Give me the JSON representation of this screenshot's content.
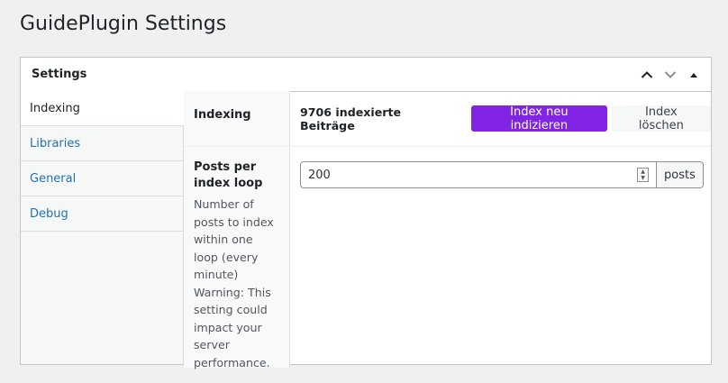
{
  "page": {
    "title": "GuidePlugin Settings"
  },
  "postbox": {
    "title": "Settings",
    "actions": {
      "move_up": "chevron-up-icon",
      "move_down": "chevron-down-icon",
      "toggle": "triangle-up-icon"
    }
  },
  "tabs": [
    {
      "label": "Indexing",
      "active": true
    },
    {
      "label": "Libraries",
      "active": false
    },
    {
      "label": "General",
      "active": false
    },
    {
      "label": "Debug",
      "active": false
    }
  ],
  "indexing": {
    "label": "Indexing",
    "count_text": "9706 indexierte Beiträge",
    "reindex_button": "Index neu indizieren",
    "delete_button": "Index löschen"
  },
  "posts_per_loop": {
    "label": "Posts per index loop",
    "description": "Number of posts to index within one loop (every minute) Warning: This setting could impact your server performance.",
    "value": "200",
    "suffix": "posts"
  },
  "colors": {
    "accent": "#8224e3",
    "link": "#2271b1",
    "background": "#f0f0f1"
  }
}
